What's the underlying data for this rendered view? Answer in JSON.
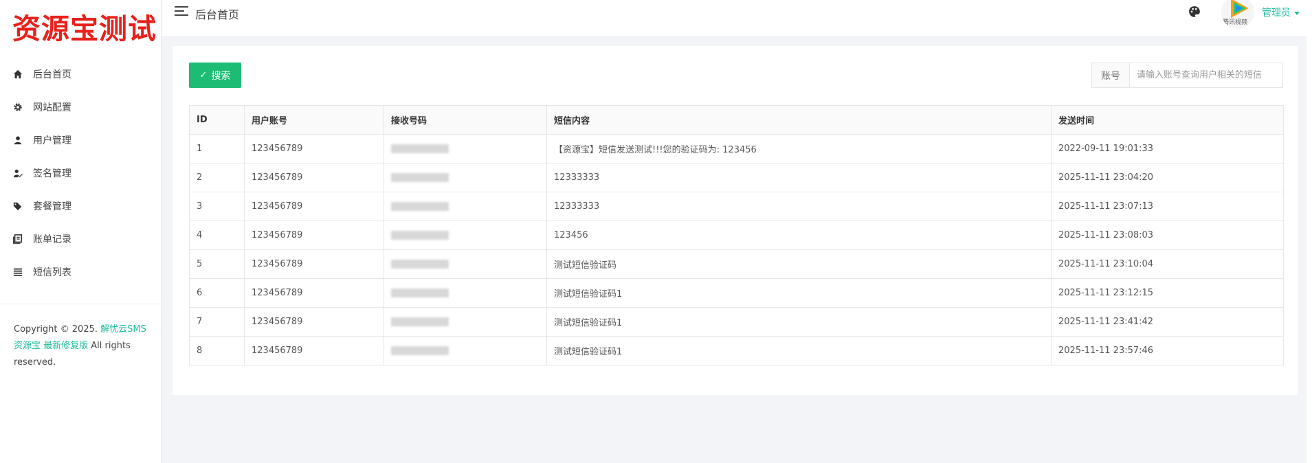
{
  "app": {
    "logo_text": "资源宝测试"
  },
  "sidebar": {
    "items": [
      {
        "label": "后台首页",
        "icon": "home-icon"
      },
      {
        "label": "网站配置",
        "icon": "gear-icon"
      },
      {
        "label": "用户管理",
        "icon": "user-icon"
      },
      {
        "label": "签名管理",
        "icon": "user-edit-icon"
      },
      {
        "label": "套餐管理",
        "icon": "tags-icon"
      },
      {
        "label": "账单记录",
        "icon": "book-icon"
      },
      {
        "label": "短信列表",
        "icon": "list-icon"
      }
    ],
    "copyright": {
      "prefix": "Copyright © 2025.",
      "link1": "解忧云SMS",
      "link2": "资源宝 最新修复版",
      "suffix": "All rights reserved."
    }
  },
  "header": {
    "title": "后台首页",
    "avatar_caption": "腾讯视频",
    "user_label": "管理员",
    "theme_icon": "palette-icon"
  },
  "toolbar": {
    "search_button": "搜索",
    "search_addon": "账号",
    "search_placeholder": "请输入账号查询用户相关的短信"
  },
  "table": {
    "columns": [
      "ID",
      "用户账号",
      "接收号码",
      "短信内容",
      "发送时间"
    ],
    "rows": [
      {
        "id": "1",
        "account": "123456789",
        "content": "【资源宝】短信发送测试!!!您的验证码为: 123456",
        "time": "2022-09-11 19:01:33"
      },
      {
        "id": "2",
        "account": "123456789",
        "content": "12333333",
        "time": "2025-11-11 23:04:20"
      },
      {
        "id": "3",
        "account": "123456789",
        "content": "12333333",
        "time": "2025-11-11 23:07:13"
      },
      {
        "id": "4",
        "account": "123456789",
        "content": "123456",
        "time": "2025-11-11 23:08:03"
      },
      {
        "id": "5",
        "account": "123456789",
        "content": "测试短信验证码",
        "time": "2025-11-11 23:10:04"
      },
      {
        "id": "6",
        "account": "123456789",
        "content": "测试短信验证码1",
        "time": "2025-11-11 23:12:15"
      },
      {
        "id": "7",
        "account": "123456789",
        "content": "测试短信验证码1",
        "time": "2025-11-11 23:41:42"
      },
      {
        "id": "8",
        "account": "123456789",
        "content": "测试短信验证码1",
        "time": "2025-11-11 23:57:46"
      }
    ]
  },
  "colors": {
    "accent": "#1abc9c",
    "primary_button": "#1dbc74",
    "logo": "#e8201b"
  }
}
